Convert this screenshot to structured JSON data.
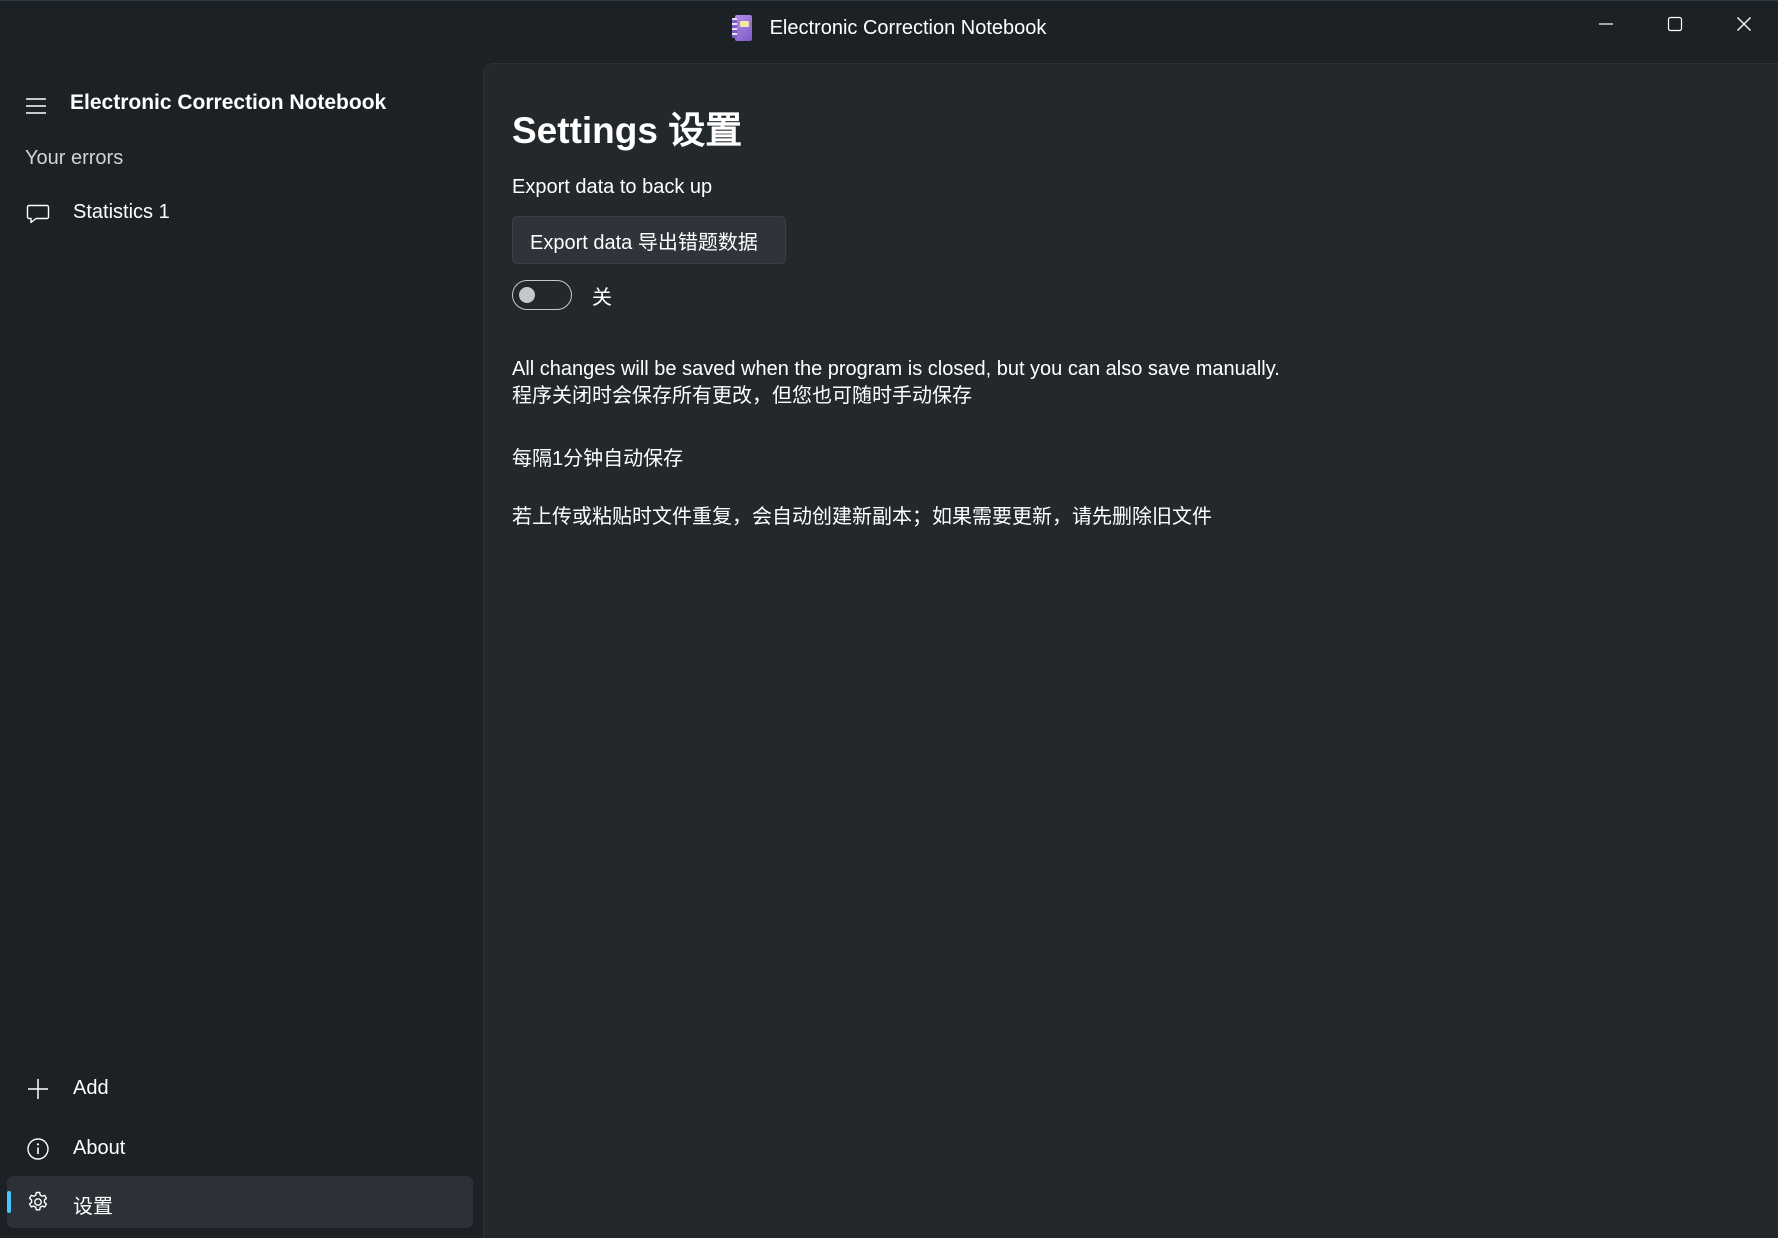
{
  "window": {
    "title": "Electronic Correction Notebook",
    "icons": {
      "app": "notebook-app-icon",
      "minimize": "minimize-icon",
      "maximize": "maximize-icon",
      "close": "close-icon"
    }
  },
  "sidebar": {
    "title": "Electronic Correction Notebook",
    "section_header": "Your errors",
    "items": [
      {
        "label": "Statistics 1",
        "icon": "chat-bubble-icon"
      }
    ],
    "footer_items": [
      {
        "label": "Add",
        "icon": "plus-icon"
      },
      {
        "label": "About",
        "icon": "info-icon"
      },
      {
        "label": "设置",
        "icon": "gear-icon",
        "selected": true
      }
    ]
  },
  "settings": {
    "page_title": "Settings 设置",
    "export_label": "Export data to back up",
    "export_button": "Export data 导出错题数据",
    "toggle": {
      "state": "off",
      "label": "关"
    },
    "info_en": "All changes will be saved when the program is closed, but you can also save manually.",
    "info_zh": "程序关闭时会保存所有更改，但您也可随时手动保存",
    "autosave": "每隔1分钟自动保存",
    "duplicate_note": "若上传或粘贴时文件重复，会自动创建新副本；如果需要更新，请先删除旧文件"
  },
  "colors": {
    "accent": "#4cc2ff",
    "sidebar_bg": "#1c2125",
    "content_bg": "#23282d",
    "selected_item_bg": "#2b3136"
  }
}
